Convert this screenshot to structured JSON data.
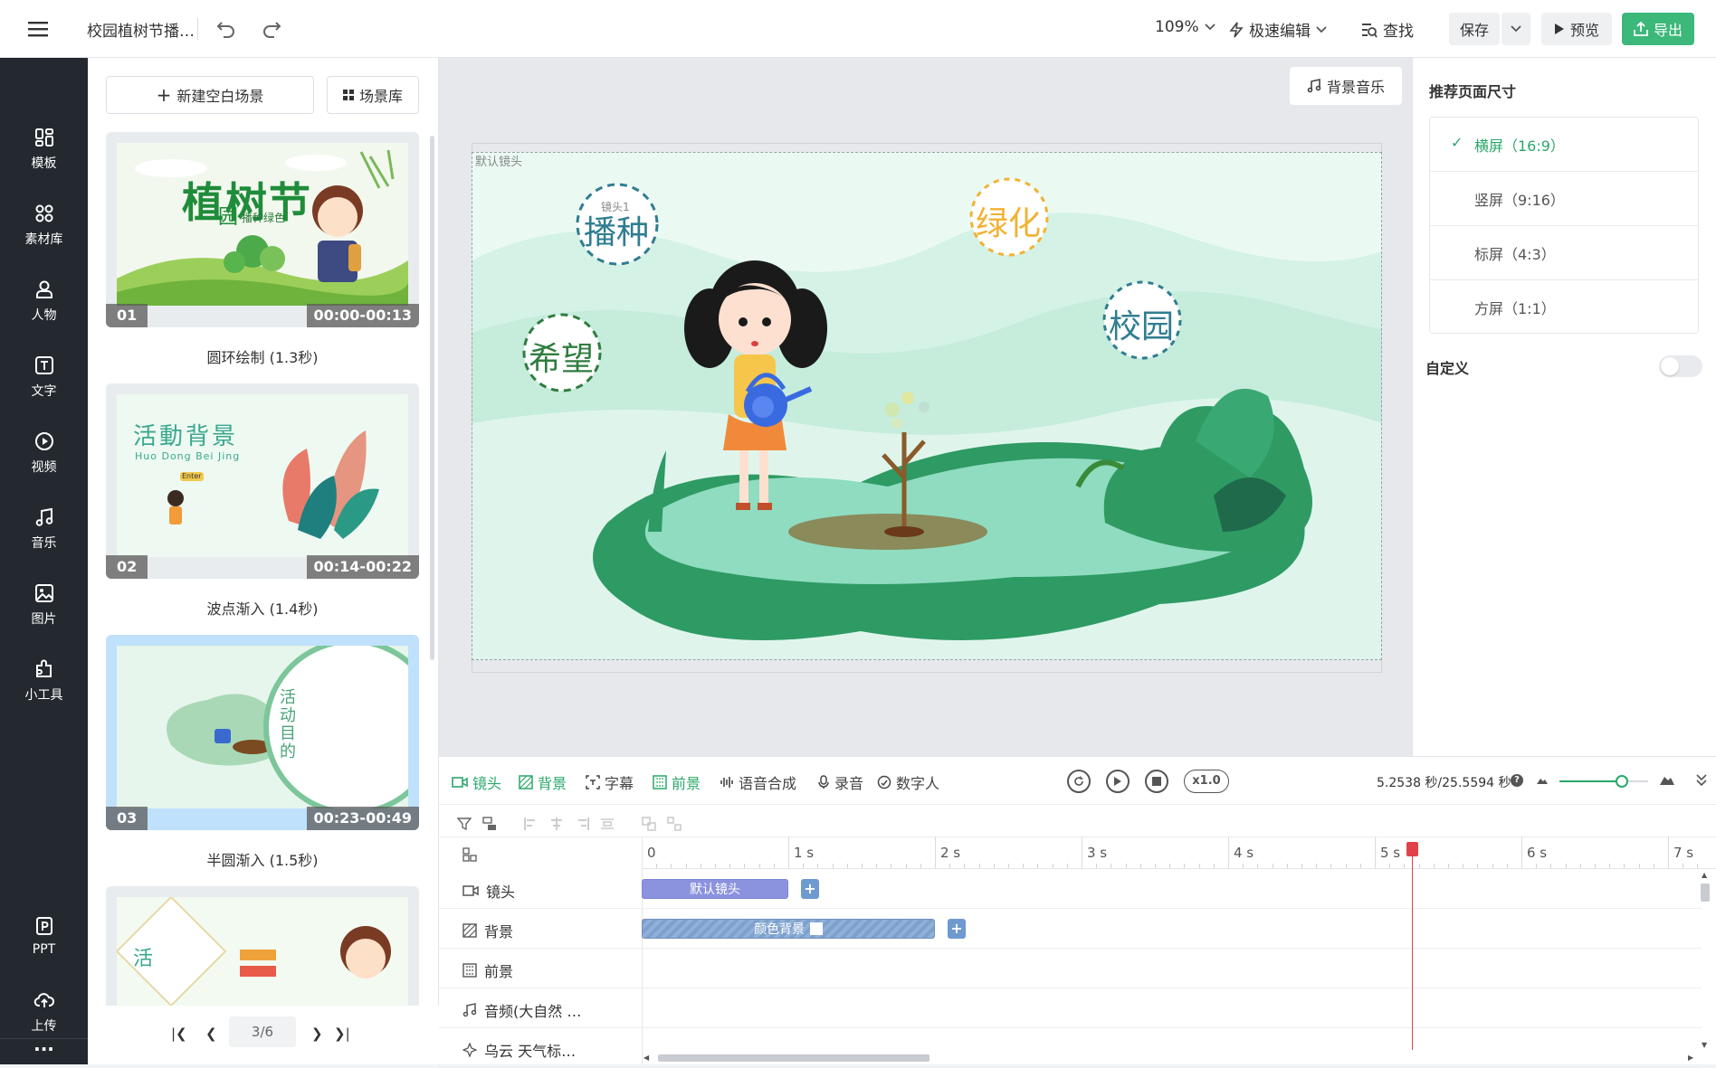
{
  "topbar": {
    "doc_title": "校园植树节播…",
    "zoom": "109%",
    "mode": "极速编辑",
    "find": "查找",
    "save": "保存",
    "preview": "预览",
    "export": "导出"
  },
  "leftnav": {
    "items": [
      "模板",
      "素材库",
      "人物",
      "文字",
      "视频",
      "音乐",
      "图片",
      "小工具"
    ],
    "bottom_items": [
      "PPT",
      "上传"
    ],
    "more": "···"
  },
  "scenes": {
    "new_scene": "新建空白场景",
    "library": "场景库",
    "list": [
      {
        "num": "01",
        "time": "00:00-00:13",
        "caption": "圆环绘制 (1.3秒)"
      },
      {
        "num": "02",
        "time": "00:14-00:22",
        "caption": "波点渐入 (1.4秒)"
      },
      {
        "num": "03",
        "time": "00:23-00:49",
        "caption": "半圆渐入 (1.5秒)"
      }
    ],
    "thumb1_title": "植树节",
    "thumb1_sub": "播种绿色",
    "thumb1_side": "园",
    "thumb2_title": "活動背景",
    "thumb2_pinyin": "Huo Dong Bei Jing",
    "thumb2_enter": "Enter",
    "thumb3_vertical": "活动目的",
    "thumb4_text": "活",
    "pager": "3/6"
  },
  "canvas": {
    "bg_music": "背景音乐",
    "default_shot": "默认镜头",
    "shot1": "镜头1",
    "words": [
      "播种",
      "希望",
      "绿化",
      "校园"
    ],
    "colors": {
      "word_teal": "#2f7d90",
      "word_yellow": "#f2b233",
      "word_green": "#2f7d3f"
    }
  },
  "rightpanel": {
    "title": "推荐页面尺寸",
    "options": [
      {
        "label": "横屏（16:9）",
        "selected": true
      },
      {
        "label": "竖屏（9:16）",
        "selected": false
      },
      {
        "label": "标屏（4:3）",
        "selected": false
      },
      {
        "label": "方屏（1:1）",
        "selected": false
      }
    ],
    "custom": "自定义",
    "custom_on": false
  },
  "timeline": {
    "tabs": [
      "镜头",
      "背景",
      "字幕",
      "前景",
      "语音合成",
      "录音",
      "数字人"
    ],
    "speed": "x1.0",
    "time": "5.2538 秒/25.5594 秒",
    "zoom_fraction": 0.7,
    "ruler": [
      "0",
      "1 s",
      "2 s",
      "3 s",
      "4 s",
      "5 s",
      "6 s",
      "7 s"
    ],
    "playhead_seconds": 5.25,
    "tracks": [
      {
        "label": "镜头",
        "clip": "默认镜头"
      },
      {
        "label": "背景",
        "clip": "颜色背景"
      },
      {
        "label": "前景",
        "clip": ""
      },
      {
        "label": "音频(大自然 …",
        "clip": ""
      },
      {
        "label": "乌云 天气标…",
        "clip": ""
      }
    ]
  }
}
